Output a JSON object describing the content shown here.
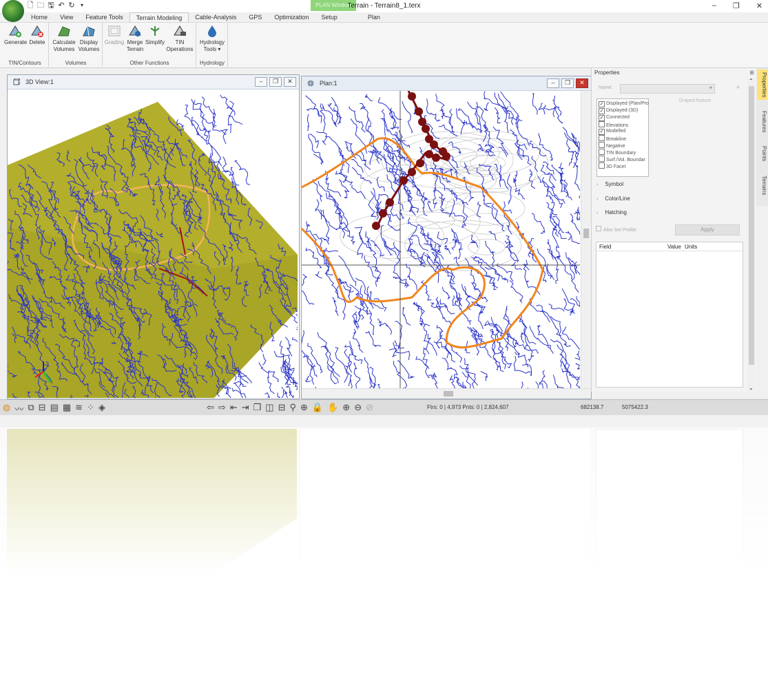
{
  "window": {
    "title": "Terrain - Terrain8_1.terx",
    "context_tab": "PLAN Window",
    "context_label": "Plan",
    "controls": [
      "–",
      "❐",
      "✕"
    ]
  },
  "quick_access": [
    "new-icon",
    "open-icon",
    "save-icon",
    "undo-icon",
    "redo-icon"
  ],
  "ribbon_tabs": [
    "Home",
    "View",
    "Feature Tools",
    "Terrain Modeling",
    "Cable-Analysis",
    "GPS",
    "Optimization",
    "Setup"
  ],
  "active_tab": "Terrain Modeling",
  "ribbon": {
    "groups": [
      {
        "label": "TIN/Contours",
        "buttons": [
          {
            "l1": "Generate",
            "l2": ""
          },
          {
            "l1": "Delete",
            "l2": ""
          }
        ]
      },
      {
        "label": "Volumes",
        "buttons": [
          {
            "l1": "Calculate",
            "l2": "Volumes"
          },
          {
            "l1": "Display",
            "l2": "Volumes"
          }
        ]
      },
      {
        "label": "Other Functions",
        "buttons": [
          {
            "l1": "Grading",
            "l2": ""
          },
          {
            "l1": "Merge",
            "l2": "Terrain"
          },
          {
            "l1": "Simplify",
            "l2": ""
          },
          {
            "l1": "TIN",
            "l2": "Operations"
          }
        ]
      },
      {
        "label": "Hydrology",
        "buttons": [
          {
            "l1": "Hydrology",
            "l2": "Tools ▾"
          }
        ]
      }
    ]
  },
  "view3d": {
    "title": "3D View:1"
  },
  "plan": {
    "title": "Plan:1"
  },
  "properties": {
    "title": "Properties",
    "name_label": "Name:",
    "draped_label": "Draped feature",
    "checklist": [
      {
        "label": "Displayed (Plan/Pro",
        "checked": true
      },
      {
        "label": "Displayed (3D)",
        "checked": true
      },
      {
        "label": "Connected",
        "checked": true
      },
      {
        "label": "Elevations",
        "checked": false
      },
      {
        "label": "Modelled",
        "checked": true
      },
      {
        "label": "Breakline",
        "checked": false
      },
      {
        "label": "Negative",
        "checked": false
      },
      {
        "label": "TIN Boundary",
        "checked": false
      },
      {
        "label": "Surf./Vol. Boundar",
        "checked": false
      },
      {
        "label": "3D Facet",
        "checked": false
      }
    ],
    "sections": [
      "Symbol",
      "Color/Line",
      "Hatching"
    ],
    "also_set_profile": "Also Set Profile",
    "apply": "Apply",
    "table_headers": [
      "Field",
      "Value",
      "Units"
    ]
  },
  "side_tabs": [
    "Properties",
    "Features",
    "Points",
    "Terrains"
  ],
  "status": {
    "counts": "Ftrs: 0 | 4,973  Pnts: 0 | 2,824,607",
    "coord_x": "682138.7",
    "coord_y": "5075422.3"
  },
  "colors": {
    "terrain": "#a9a526",
    "streams": "#2a34c8",
    "boundary": "#f0861e",
    "path": "#7a1010"
  }
}
